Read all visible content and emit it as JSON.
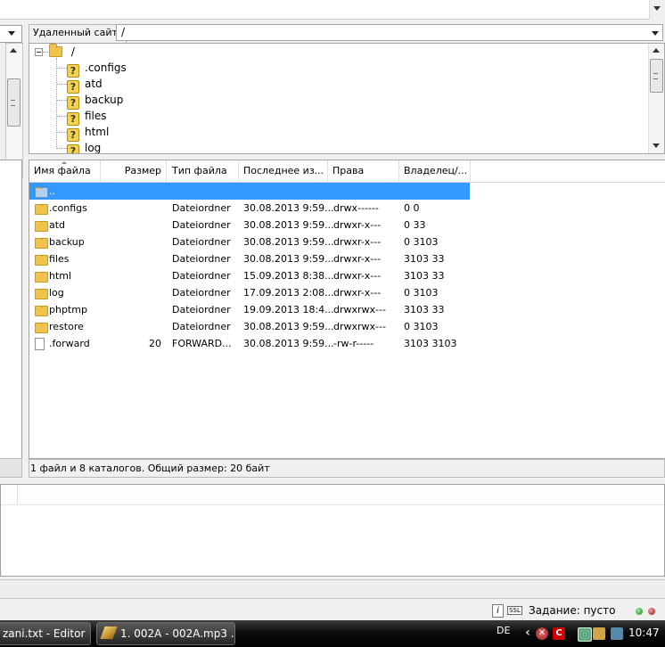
{
  "remote_site": {
    "label": "Удаленный сайт:",
    "path": "/"
  },
  "tree": {
    "root": "/",
    "items": [
      ".configs",
      "atd",
      "backup",
      "files",
      "html",
      "log"
    ]
  },
  "file_list": {
    "columns": [
      "Имя файла",
      "Размер",
      "Тип файла",
      "Последнее из...",
      "Права",
      "Владелец/..."
    ],
    "rows": [
      {
        "name": "..",
        "size": "",
        "type": "",
        "modified": "",
        "perms": "",
        "owner": "",
        "kind": "parent",
        "selected": true
      },
      {
        "name": ".configs",
        "size": "",
        "type": "Dateiordner",
        "modified": "30.08.2013 9:59...",
        "perms": "drwx------",
        "owner": "0 0",
        "kind": "folder"
      },
      {
        "name": "atd",
        "size": "",
        "type": "Dateiordner",
        "modified": "30.08.2013 9:59...",
        "perms": "drwxr-x---",
        "owner": "0 33",
        "kind": "folder"
      },
      {
        "name": "backup",
        "size": "",
        "type": "Dateiordner",
        "modified": "30.08.2013 9:59...",
        "perms": "drwxr-x---",
        "owner": "0 3103",
        "kind": "folder"
      },
      {
        "name": "files",
        "size": "",
        "type": "Dateiordner",
        "modified": "30.08.2013 9:59...",
        "perms": "drwxr-x---",
        "owner": "3103 33",
        "kind": "folder"
      },
      {
        "name": "html",
        "size": "",
        "type": "Dateiordner",
        "modified": "15.09.2013 8:38...",
        "perms": "drwxr-x---",
        "owner": "3103 33",
        "kind": "folder"
      },
      {
        "name": "log",
        "size": "",
        "type": "Dateiordner",
        "modified": "17.09.2013 2:08...",
        "perms": "drwxr-x---",
        "owner": "0 3103",
        "kind": "folder"
      },
      {
        "name": "phptmp",
        "size": "",
        "type": "Dateiordner",
        "modified": "19.09.2013 18:4...",
        "perms": "drwxrwx---",
        "owner": "3103 33",
        "kind": "folder"
      },
      {
        "name": "restore",
        "size": "",
        "type": "Dateiordner",
        "modified": "30.08.2013 9:59...",
        "perms": "drwxrwx---",
        "owner": "0 3103",
        "kind": "folder"
      },
      {
        "name": ".forward",
        "size": "20",
        "type": "FORWARD...",
        "modified": "30.08.2013 9:59...",
        "perms": "-rw-r-----",
        "owner": "3103 3103",
        "kind": "file"
      }
    ]
  },
  "status_line": "1 файл и 8 каталогов. Общий размер: 20 байт",
  "app_status": {
    "queue_status": "Задание: пусто",
    "badge": "SSL"
  },
  "taskbar": {
    "task_editor": "zani.txt - Editor",
    "task_mp3": "1. 002A - 002A.mp3 ...",
    "language": "DE",
    "clock": "10:47"
  },
  "icons": {
    "tree_item": "question-folder-icon",
    "folder": "folder-icon",
    "file": "file-icon"
  },
  "colors": {
    "selection": "#3399ff",
    "folder": "#f1c34e"
  }
}
